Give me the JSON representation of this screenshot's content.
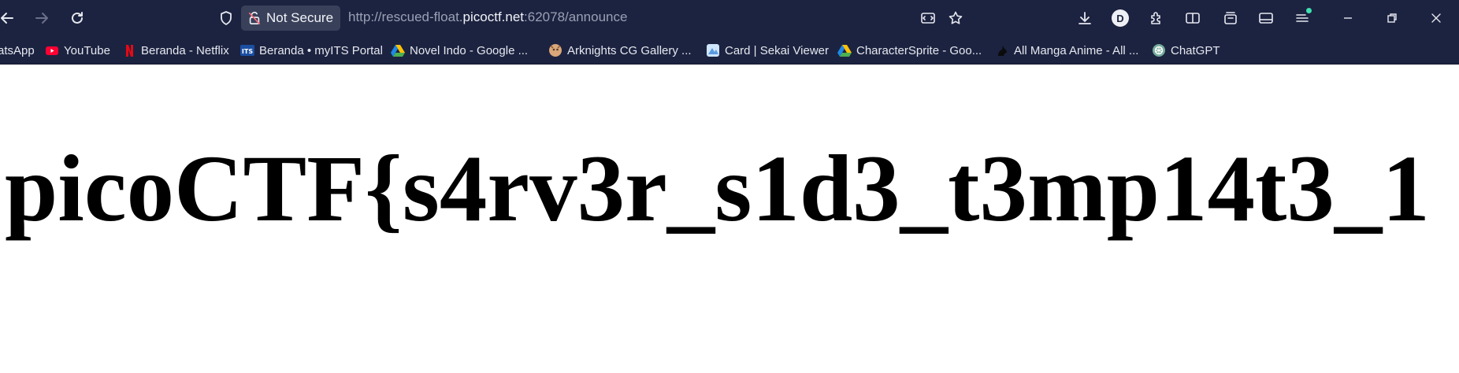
{
  "browser": {
    "security_label": "Not Secure",
    "url": {
      "prefix": "http://rescued-float.",
      "host": "picoctf.net",
      "suffix": ":62078/announce"
    },
    "account_initial": "D",
    "nav": {
      "back_icon": "arrow-left-icon",
      "forward_icon": "arrow-right-icon",
      "reload_icon": "reload-icon"
    }
  },
  "bookmarks": [
    {
      "label": "atsApp",
      "icon": "whatsapp-icon"
    },
    {
      "label": "YouTube",
      "icon": "youtube-icon"
    },
    {
      "label": "Beranda - Netflix",
      "icon": "netflix-icon"
    },
    {
      "label": "Beranda • myITS Portal",
      "icon": "its-icon"
    },
    {
      "label": "Novel Indo - Google ...",
      "icon": "google-drive-icon"
    },
    {
      "label": "Arknights CG Gallery ...",
      "icon": "arknights-icon"
    },
    {
      "label": "Card | Sekai Viewer",
      "icon": "sekai-icon"
    },
    {
      "label": "CharacterSprite - Goo...",
      "icon": "google-drive-icon"
    },
    {
      "label": "All Manga Anime - All ...",
      "icon": "manga-icon"
    },
    {
      "label": "ChatGPT",
      "icon": "chatgpt-icon"
    }
  ],
  "page": {
    "heading": "picoCTF{s4rv3r_s1d3_t3mp14t3_1"
  },
  "colors": {
    "chrome": "#1c2340",
    "pill": "#39405a",
    "page_bg": "#ffffff",
    "heading": "#000000"
  }
}
